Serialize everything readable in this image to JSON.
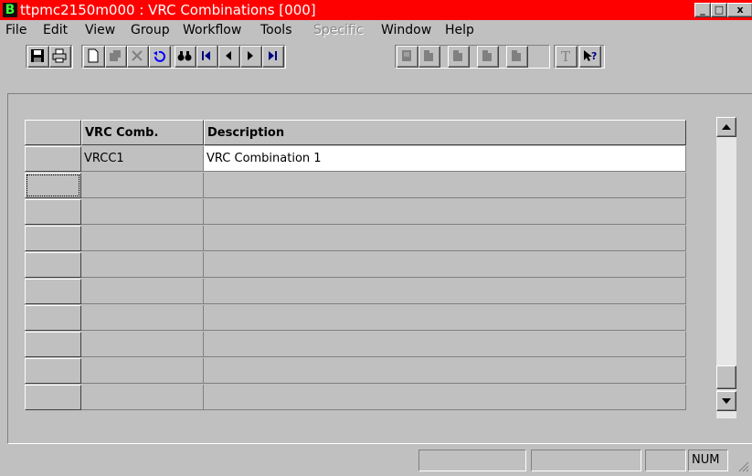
{
  "window": {
    "title": "ttpmc2150m000 : VRC Combinations [000]",
    "app_icon_letter": "B",
    "minimize": "_",
    "maximize": "□",
    "close": "x"
  },
  "menu": [
    "File",
    "Edit",
    "View",
    "Group",
    "Workflow",
    "Tools",
    "Specific",
    "Window",
    "Help"
  ],
  "menu_disabled": [
    "Specific"
  ],
  "toolbar": {
    "icons": [
      "save-icon",
      "print-icon",
      "new-icon",
      "duplicate-icon",
      "delete-icon",
      "undo-icon",
      "find-icon",
      "first-record-icon",
      "previous-record-icon",
      "next-record-icon",
      "last-record-icon",
      "form1-icon",
      "form2-icon",
      "form3-icon",
      "form4-icon",
      "form5-icon",
      "text-icon",
      "help-pointer-icon"
    ]
  },
  "grid": {
    "columns": [
      "VRC Comb.",
      "Description"
    ],
    "rows": [
      {
        "vrc_comb": "VRCC1",
        "description": "VRC Combination 1"
      },
      {
        "vrc_comb": "",
        "description": ""
      },
      {
        "vrc_comb": "",
        "description": ""
      },
      {
        "vrc_comb": "",
        "description": ""
      },
      {
        "vrc_comb": "",
        "description": ""
      },
      {
        "vrc_comb": "",
        "description": ""
      },
      {
        "vrc_comb": "",
        "description": ""
      },
      {
        "vrc_comb": "",
        "description": ""
      },
      {
        "vrc_comb": "",
        "description": ""
      },
      {
        "vrc_comb": "",
        "description": ""
      }
    ]
  },
  "statusbar": {
    "fields": [
      "",
      "",
      "",
      "NUM"
    ]
  },
  "colors": {
    "titlebar": "#ff0000",
    "face": "#c0c0c0",
    "app_icon_letter": "#3cff3c"
  }
}
